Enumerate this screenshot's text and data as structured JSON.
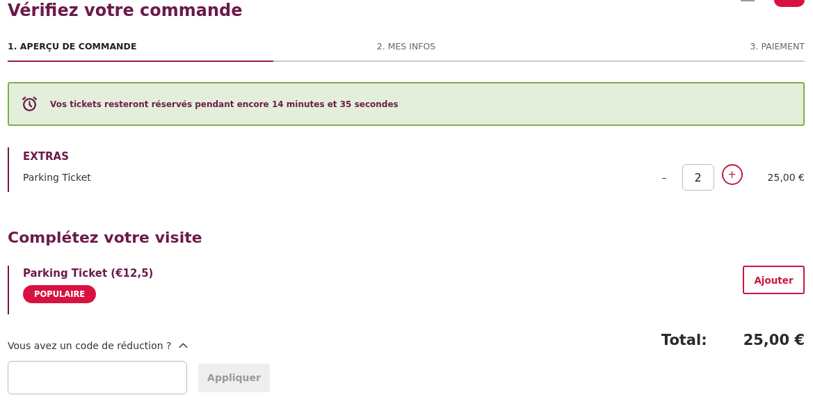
{
  "title": "Vérifiez votre commande",
  "steps": [
    {
      "label": "1. APERÇU DE COMMANDE",
      "selected": true
    },
    {
      "label": "2. MES INFOS",
      "selected": false
    },
    {
      "label": "3. PAIEMENT",
      "selected": false
    }
  ],
  "timer_notice": "Vos tickets resteront réservés pendant encore 14 minutes et 35 secondes",
  "extras": {
    "heading": "EXTRAS",
    "items": [
      {
        "name": "Parking Ticket",
        "minus": "–",
        "quantity": "2",
        "plus": "+",
        "price": "25,00 €"
      }
    ]
  },
  "upsell": {
    "heading": "Complétez votre visite",
    "items": [
      {
        "name": "Parking Ticket (€12,5)",
        "badge": "POPULAIRE",
        "button": "Ajouter"
      }
    ]
  },
  "discount": {
    "label": "Vous avez un code de réduction ?",
    "expanded": true,
    "button": "Appliquer",
    "button_disabled": true
  },
  "total": {
    "label": "Total:",
    "value": "25,00 €"
  }
}
